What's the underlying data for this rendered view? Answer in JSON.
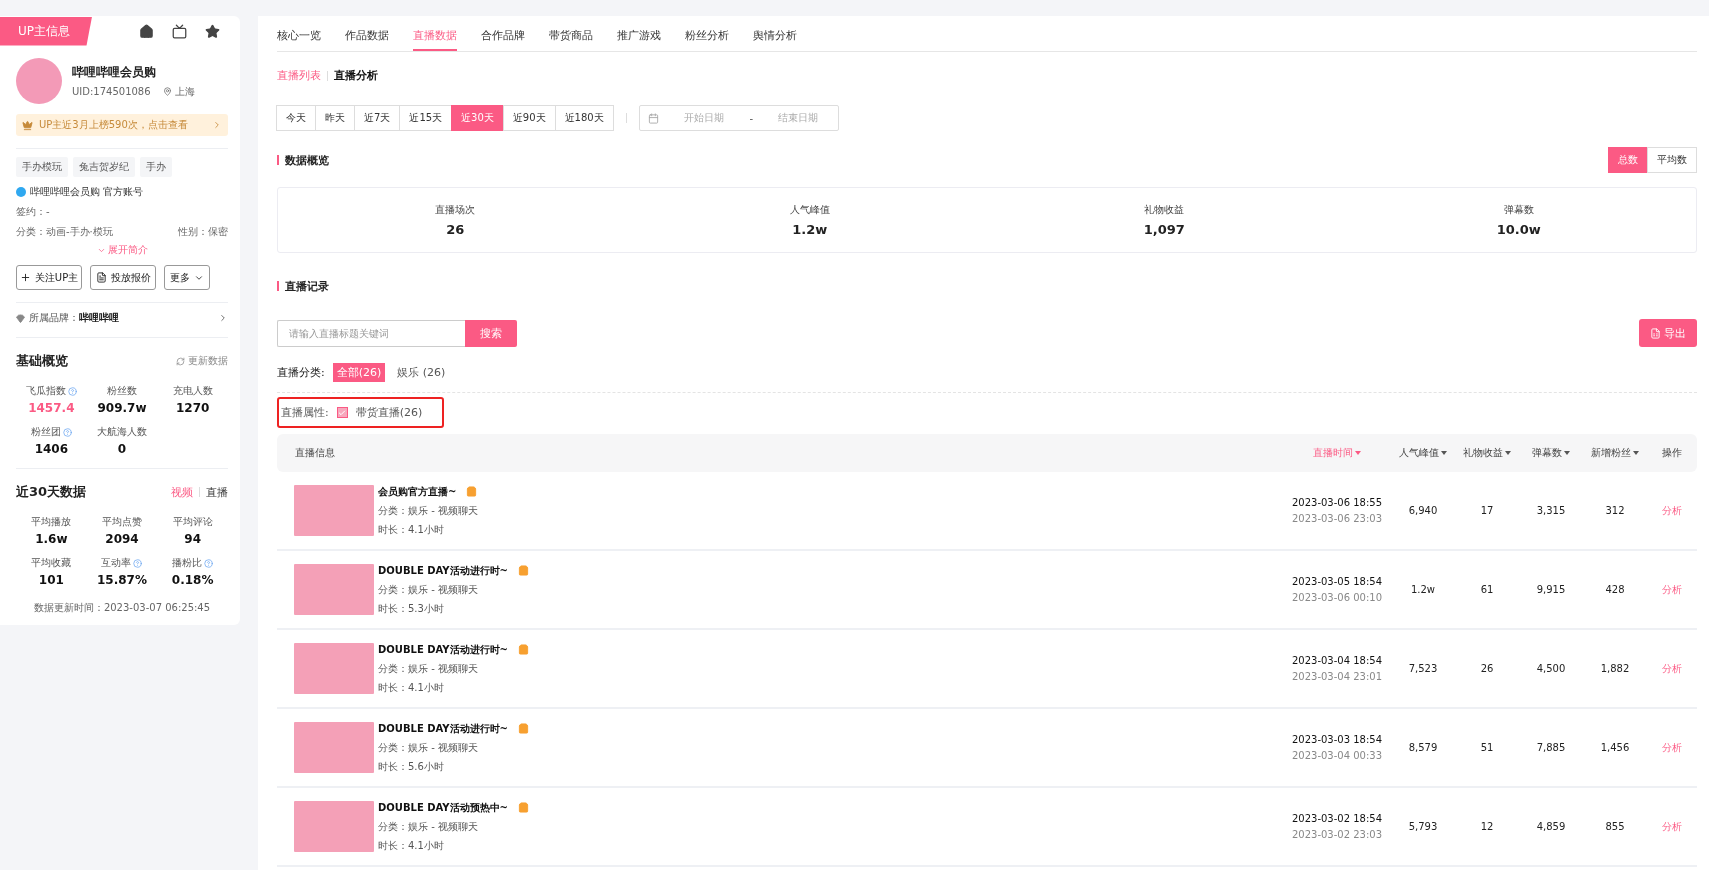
{
  "sidebar": {
    "badge": "UP主信息",
    "profile": {
      "name": "哔哩哔哩会员购",
      "uid": "UID:174501086",
      "location": "上海"
    },
    "rank_banner": "UP主近3月上榜590次，点击查看",
    "tags": [
      "手办模玩",
      "兔吉贺岁纪",
      "手办"
    ],
    "official": "哔哩哔哩会员购 官方账号",
    "sign": {
      "label": "签约：",
      "value": "-"
    },
    "category": {
      "label": "分类：",
      "value": "动画-手办·模玩"
    },
    "gender": {
      "label": "性别：",
      "value": "保密"
    },
    "expand": "展开简介",
    "actions": [
      {
        "kind": "follow",
        "label": "关注UP主"
      },
      {
        "kind": "quote",
        "label": "投放报价"
      },
      {
        "kind": "more",
        "label": "更多"
      }
    ],
    "brand": {
      "label": "所属品牌：",
      "value": "哔哩哔哩"
    },
    "basic": {
      "title": "基础概览",
      "refresh": "更新数据",
      "stats": [
        {
          "label": "飞瓜指数",
          "value": "1457.4",
          "help": true,
          "highlight": true
        },
        {
          "label": "粉丝数",
          "value": "909.7w",
          "help": false,
          "highlight": false
        },
        {
          "label": "充电人数",
          "value": "1270",
          "help": false,
          "highlight": false
        },
        {
          "label": "粉丝团",
          "value": "1406",
          "help": true,
          "highlight": false
        },
        {
          "label": "大航海人数",
          "value": "0",
          "help": false,
          "highlight": false
        }
      ]
    },
    "recent": {
      "title": "近30天数据",
      "toggle": [
        {
          "label": "视频",
          "selected": true
        },
        {
          "label": "直播",
          "selected": false
        }
      ],
      "stats": [
        {
          "label": "平均播放",
          "value": "1.6w",
          "help": false,
          "highlight": false
        },
        {
          "label": "平均点赞",
          "value": "2094",
          "help": false,
          "highlight": false
        },
        {
          "label": "平均评论",
          "value": "94",
          "help": false,
          "highlight": false
        },
        {
          "label": "平均收藏",
          "value": "101",
          "help": false,
          "highlight": false
        },
        {
          "label": "互动率",
          "value": "15.87%",
          "help": true,
          "highlight": false
        },
        {
          "label": "播粉比",
          "value": "0.18%",
          "help": true,
          "highlight": false
        }
      ],
      "updated": "数据更新时间：2023-03-07 06:25:45"
    }
  },
  "tabs": [
    {
      "label": "核心一览",
      "selected": false
    },
    {
      "label": "作品数据",
      "selected": false
    },
    {
      "label": "直播数据",
      "selected": true
    },
    {
      "label": "合作品牌",
      "selected": false
    },
    {
      "label": "带货商品",
      "selected": false
    },
    {
      "label": "推广游戏",
      "selected": false
    },
    {
      "label": "粉丝分析",
      "selected": false
    },
    {
      "label": "舆情分析",
      "selected": false
    }
  ],
  "subtabs": [
    {
      "label": "直播列表",
      "selected": true
    },
    {
      "label": "直播分析",
      "selected": false
    }
  ],
  "date_ranges": [
    {
      "label": "今天",
      "selected": false
    },
    {
      "label": "昨天",
      "selected": false
    },
    {
      "label": "近7天",
      "selected": false
    },
    {
      "label": "近15天",
      "selected": false
    },
    {
      "label": "近30天",
      "selected": true
    },
    {
      "label": "近90天",
      "selected": false
    },
    {
      "label": "近180天",
      "selected": false
    }
  ],
  "date_picker": {
    "start_placeholder": "开始日期",
    "separator": "-",
    "end_placeholder": "结束日期"
  },
  "overview": {
    "title": "数据概览",
    "modes": [
      {
        "label": "总数",
        "selected": true
      },
      {
        "label": "平均数",
        "selected": false
      }
    ],
    "stats": [
      {
        "label": "直播场次",
        "value": "26"
      },
      {
        "label": "人气峰值",
        "value": "1.2w"
      },
      {
        "label": "礼物收益",
        "value": "1,097"
      },
      {
        "label": "弹幕数",
        "value": "10.0w"
      }
    ]
  },
  "records": {
    "title": "直播记录",
    "search": {
      "placeholder": "请输入直播标题关键词",
      "button": "搜索"
    },
    "export": "导出",
    "category": {
      "label": "直播分类:",
      "options": [
        {
          "label": "全部(26)",
          "selected": true
        },
        {
          "label": "娱乐 (26)",
          "selected": false
        }
      ]
    },
    "attribute": {
      "label": "直播属性:",
      "option": {
        "label": "带货直播(26)",
        "checked": true
      }
    },
    "table": {
      "columns": [
        {
          "label": "直播信息",
          "sortable": false,
          "sorted": false
        },
        {
          "label": "直播时间",
          "sortable": true,
          "sorted": true
        },
        {
          "label": "人气峰值",
          "sortable": true,
          "sorted": false
        },
        {
          "label": "礼物收益",
          "sortable": true,
          "sorted": false
        },
        {
          "label": "弹幕数",
          "sortable": true,
          "sorted": false
        },
        {
          "label": "新增粉丝",
          "sortable": true,
          "sorted": false
        },
        {
          "label": "操作",
          "sortable": false,
          "sorted": false
        }
      ],
      "rows": [
        {
          "title": "会员购官方直播~",
          "category": "分类：娱乐 - 视频聊天",
          "duration": "时长：4.1小时",
          "start": "2023-03-06 18:55",
          "end": "2023-03-06 23:03",
          "peak": "6,940",
          "gifts": "17",
          "danmaku": "3,315",
          "new_fans": "312",
          "action": "分析"
        },
        {
          "title": "DOUBLE DAY活动进行时~",
          "category": "分类：娱乐 - 视频聊天",
          "duration": "时长：5.3小时",
          "start": "2023-03-05 18:54",
          "end": "2023-03-06 00:10",
          "peak": "1.2w",
          "gifts": "61",
          "danmaku": "9,915",
          "new_fans": "428",
          "action": "分析"
        },
        {
          "title": "DOUBLE DAY活动进行时~",
          "category": "分类：娱乐 - 视频聊天",
          "duration": "时长：4.1小时",
          "start": "2023-03-04 18:54",
          "end": "2023-03-04 23:01",
          "peak": "7,523",
          "gifts": "26",
          "danmaku": "4,500",
          "new_fans": "1,882",
          "action": "分析"
        },
        {
          "title": "DOUBLE DAY活动进行时~",
          "category": "分类：娱乐 - 视频聊天",
          "duration": "时长：5.6小时",
          "start": "2023-03-03 18:54",
          "end": "2023-03-04 00:33",
          "peak": "8,579",
          "gifts": "51",
          "danmaku": "7,885",
          "new_fans": "1,456",
          "action": "分析"
        },
        {
          "title": "DOUBLE DAY活动预热中~",
          "category": "分类：娱乐 - 视频聊天",
          "duration": "时长：4.1小时",
          "start": "2023-03-02 18:54",
          "end": "2023-03-02 23:03",
          "peak": "5,793",
          "gifts": "12",
          "danmaku": "4,859",
          "new_fans": "855",
          "action": "分析"
        }
      ]
    }
  }
}
